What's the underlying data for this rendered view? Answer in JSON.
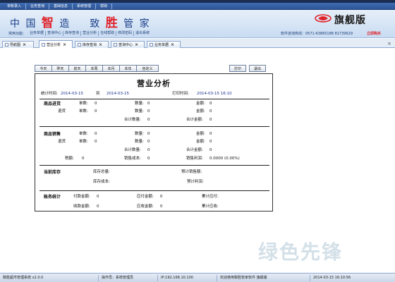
{
  "menubar": [
    "单账录入",
    "业务查询",
    "基础信息",
    "系统管理",
    "帮助"
  ],
  "header": {
    "brand_a": "中 国",
    "brand_accent1": "智",
    "brand_b": "造",
    "brand_c": "致",
    "brand_accent2": "胜",
    "brand_d": "管 家",
    "edition": "旗舰版",
    "quick_label": "常用功能：",
    "quick_items": [
      "业务单据",
      "查询中心",
      "库存查询",
      "营业分析",
      "在线帮助",
      "修改密码",
      "退出系统"
    ],
    "phone": "软件咨询热线：0571-63865188 81739629",
    "buy": "立即购买"
  },
  "tabs": [
    {
      "label": "导航图"
    },
    {
      "label": "营业分析"
    },
    {
      "label": "库存查询"
    },
    {
      "label": "查询中心"
    },
    {
      "label": "业务单据"
    }
  ],
  "toolbar": {
    "left": [
      "今天",
      "昨天",
      "前天",
      "本周",
      "本月",
      "本年",
      "自定义"
    ],
    "print": "打印",
    "exit": "退出"
  },
  "report": {
    "title": "营业分析",
    "period_label": "统计时间:",
    "date_from": "2014-03-15",
    "date_to_label": "到",
    "date_to": "2014-03-15",
    "print_time_label": "打印时间:",
    "print_time": "2014-03-15  16:10",
    "purchase": {
      "title": "商品进货",
      "return_label": "退货",
      "count_label": "单数:",
      "count": "0",
      "return_count": "0",
      "qty_label": "数量:",
      "qty": "0",
      "return_qty": "0",
      "amt_label": "金额:",
      "amt": "0",
      "return_amt": "0",
      "total_qty_label": "合计数量:",
      "total_qty": "0",
      "total_amt_label": "合计金额:",
      "total_amt": "0"
    },
    "sales": {
      "title": "商品销售",
      "return_label": "退货",
      "count_label": "单数:",
      "count": "0",
      "return_count": "0",
      "qty_label": "数量:",
      "qty": "0",
      "return_qty": "0",
      "amt_label": "金额:",
      "amt": "0",
      "return_amt": "0",
      "total_qty_label": "合计数量:",
      "total_qty": "0",
      "total_amt_label": "合计金额:",
      "total_amt": "0",
      "tax_label": "税额:",
      "tax": "0",
      "cost_label": "销售成本:",
      "cost": "0",
      "profit_label": "销售利润:",
      "profit": "0.0000 (0.00%)"
    },
    "inventory": {
      "title": "当前库存",
      "total_qty_label": "库存总量:",
      "total_cost_label": "库存成本:",
      "est_sales_label": "预计销售额:",
      "est_profit_label": "预计利润:"
    },
    "accounts": {
      "title": "账务统计",
      "paid_label": "付款金额:",
      "paid": "0",
      "received_label": "收款金额:",
      "received": "0",
      "payable_label": "应付金额:",
      "payable": "0",
      "receivable_label": "应收金额:",
      "receivable": "0",
      "acc_payable_label": "累计应付:",
      "acc_receivable_label": "累计应收:"
    }
  },
  "watermark": "绿色先锋",
  "status": [
    "致胜超市管理系统 v2.0.0",
    "操作员：系统管理员",
    "IP:192.168.10.100",
    "欢迎使用致胜管家软件 旗舰版",
    "2014-03-15 16:10:56"
  ],
  "colors": {
    "brand_blue": "#1a3f8a",
    "accent_red": "#e0222a",
    "value_blue": "#1a2f8c"
  }
}
